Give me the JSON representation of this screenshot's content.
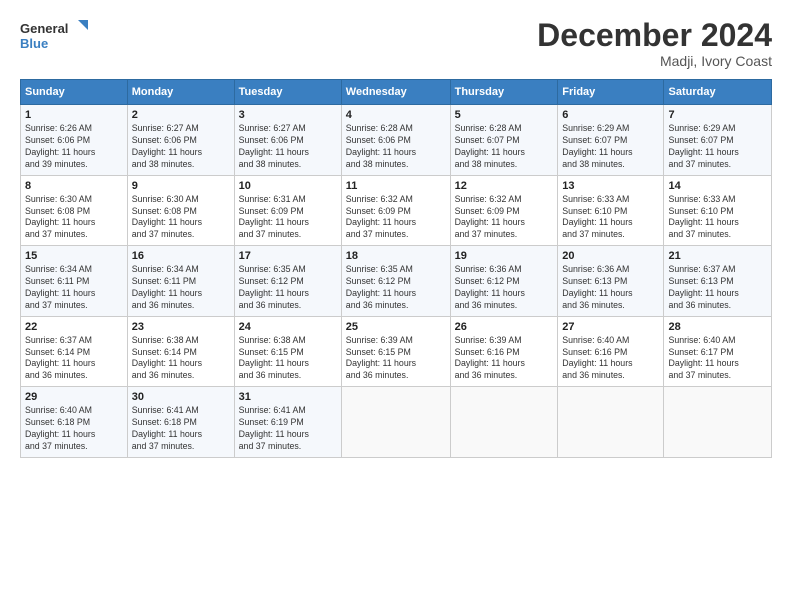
{
  "header": {
    "logo_line1": "General",
    "logo_line2": "Blue",
    "title": "December 2024",
    "subtitle": "Madji, Ivory Coast"
  },
  "calendar": {
    "headers": [
      "Sunday",
      "Monday",
      "Tuesday",
      "Wednesday",
      "Thursday",
      "Friday",
      "Saturday"
    ],
    "weeks": [
      [
        {
          "day": "",
          "info": ""
        },
        {
          "day": "2",
          "info": "Sunrise: 6:27 AM\nSunset: 6:06 PM\nDaylight: 11 hours\nand 38 minutes."
        },
        {
          "day": "3",
          "info": "Sunrise: 6:27 AM\nSunset: 6:06 PM\nDaylight: 11 hours\nand 38 minutes."
        },
        {
          "day": "4",
          "info": "Sunrise: 6:28 AM\nSunset: 6:06 PM\nDaylight: 11 hours\nand 38 minutes."
        },
        {
          "day": "5",
          "info": "Sunrise: 6:28 AM\nSunset: 6:07 PM\nDaylight: 11 hours\nand 38 minutes."
        },
        {
          "day": "6",
          "info": "Sunrise: 6:29 AM\nSunset: 6:07 PM\nDaylight: 11 hours\nand 38 minutes."
        },
        {
          "day": "7",
          "info": "Sunrise: 6:29 AM\nSunset: 6:07 PM\nDaylight: 11 hours\nand 37 minutes."
        }
      ],
      [
        {
          "day": "1",
          "info": "Sunrise: 6:26 AM\nSunset: 6:06 PM\nDaylight: 11 hours\nand 39 minutes."
        },
        {
          "day": "",
          "info": ""
        },
        {
          "day": "",
          "info": ""
        },
        {
          "day": "",
          "info": ""
        },
        {
          "day": "",
          "info": ""
        },
        {
          "day": "",
          "info": ""
        },
        {
          "day": "",
          "info": ""
        }
      ],
      [
        {
          "day": "8",
          "info": "Sunrise: 6:30 AM\nSunset: 6:08 PM\nDaylight: 11 hours\nand 37 minutes."
        },
        {
          "day": "9",
          "info": "Sunrise: 6:30 AM\nSunset: 6:08 PM\nDaylight: 11 hours\nand 37 minutes."
        },
        {
          "day": "10",
          "info": "Sunrise: 6:31 AM\nSunset: 6:09 PM\nDaylight: 11 hours\nand 37 minutes."
        },
        {
          "day": "11",
          "info": "Sunrise: 6:32 AM\nSunset: 6:09 PM\nDaylight: 11 hours\nand 37 minutes."
        },
        {
          "day": "12",
          "info": "Sunrise: 6:32 AM\nSunset: 6:09 PM\nDaylight: 11 hours\nand 37 minutes."
        },
        {
          "day": "13",
          "info": "Sunrise: 6:33 AM\nSunset: 6:10 PM\nDaylight: 11 hours\nand 37 minutes."
        },
        {
          "day": "14",
          "info": "Sunrise: 6:33 AM\nSunset: 6:10 PM\nDaylight: 11 hours\nand 37 minutes."
        }
      ],
      [
        {
          "day": "15",
          "info": "Sunrise: 6:34 AM\nSunset: 6:11 PM\nDaylight: 11 hours\nand 37 minutes."
        },
        {
          "day": "16",
          "info": "Sunrise: 6:34 AM\nSunset: 6:11 PM\nDaylight: 11 hours\nand 36 minutes."
        },
        {
          "day": "17",
          "info": "Sunrise: 6:35 AM\nSunset: 6:12 PM\nDaylight: 11 hours\nand 36 minutes."
        },
        {
          "day": "18",
          "info": "Sunrise: 6:35 AM\nSunset: 6:12 PM\nDaylight: 11 hours\nand 36 minutes."
        },
        {
          "day": "19",
          "info": "Sunrise: 6:36 AM\nSunset: 6:12 PM\nDaylight: 11 hours\nand 36 minutes."
        },
        {
          "day": "20",
          "info": "Sunrise: 6:36 AM\nSunset: 6:13 PM\nDaylight: 11 hours\nand 36 minutes."
        },
        {
          "day": "21",
          "info": "Sunrise: 6:37 AM\nSunset: 6:13 PM\nDaylight: 11 hours\nand 36 minutes."
        }
      ],
      [
        {
          "day": "22",
          "info": "Sunrise: 6:37 AM\nSunset: 6:14 PM\nDaylight: 11 hours\nand 36 minutes."
        },
        {
          "day": "23",
          "info": "Sunrise: 6:38 AM\nSunset: 6:14 PM\nDaylight: 11 hours\nand 36 minutes."
        },
        {
          "day": "24",
          "info": "Sunrise: 6:38 AM\nSunset: 6:15 PM\nDaylight: 11 hours\nand 36 minutes."
        },
        {
          "day": "25",
          "info": "Sunrise: 6:39 AM\nSunset: 6:15 PM\nDaylight: 11 hours\nand 36 minutes."
        },
        {
          "day": "26",
          "info": "Sunrise: 6:39 AM\nSunset: 6:16 PM\nDaylight: 11 hours\nand 36 minutes."
        },
        {
          "day": "27",
          "info": "Sunrise: 6:40 AM\nSunset: 6:16 PM\nDaylight: 11 hours\nand 36 minutes."
        },
        {
          "day": "28",
          "info": "Sunrise: 6:40 AM\nSunset: 6:17 PM\nDaylight: 11 hours\nand 37 minutes."
        }
      ],
      [
        {
          "day": "29",
          "info": "Sunrise: 6:40 AM\nSunset: 6:18 PM\nDaylight: 11 hours\nand 37 minutes."
        },
        {
          "day": "30",
          "info": "Sunrise: 6:41 AM\nSunset: 6:18 PM\nDaylight: 11 hours\nand 37 minutes."
        },
        {
          "day": "31",
          "info": "Sunrise: 6:41 AM\nSunset: 6:19 PM\nDaylight: 11 hours\nand 37 minutes."
        },
        {
          "day": "",
          "info": ""
        },
        {
          "day": "",
          "info": ""
        },
        {
          "day": "",
          "info": ""
        },
        {
          "day": "",
          "info": ""
        }
      ]
    ]
  }
}
